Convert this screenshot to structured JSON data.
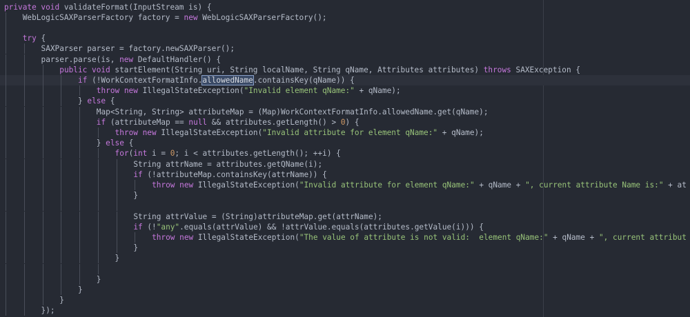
{
  "editor": {
    "highlight_color": "#c678dd",
    "string_color": "#98c379",
    "current_line": 8,
    "lines": [
      {
        "indent": 0,
        "tokens": [
          [
            "kw",
            "private void "
          ],
          [
            "pl",
            "validateFormat(InputStream is) {"
          ]
        ]
      },
      {
        "indent": 1,
        "tokens": [
          [
            "pl",
            "WebLogicSAXParserFactory factory = "
          ],
          [
            "kw",
            "new "
          ],
          [
            "pl",
            "WebLogicSAXParserFactory();"
          ]
        ]
      },
      {
        "indent": 1,
        "tokens": []
      },
      {
        "indent": 1,
        "tokens": [
          [
            "kw",
            "try "
          ],
          [
            "pl",
            "{"
          ]
        ]
      },
      {
        "indent": 2,
        "tokens": [
          [
            "pl",
            "SAXParser parser = factory.newSAXParser();"
          ]
        ]
      },
      {
        "indent": 2,
        "tokens": [
          [
            "pl",
            "parser.parse(is, "
          ],
          [
            "kw",
            "new "
          ],
          [
            "pl",
            "DefaultHandler() {"
          ]
        ]
      },
      {
        "indent": 3,
        "tokens": [
          [
            "kw",
            "public void "
          ],
          [
            "pl",
            "startElement(String uri, String localName, String qName, Attributes attributes) "
          ],
          [
            "kw",
            "throws "
          ],
          [
            "pl",
            "SAXException {"
          ]
        ]
      },
      {
        "indent": 4,
        "tokens": [
          [
            "kw",
            "if "
          ],
          [
            "pl",
            "(!WorkContextFormatInfo."
          ],
          [
            "hl",
            "allowedName"
          ],
          [
            "pl",
            ".containsKey(qName)) {"
          ]
        ]
      },
      {
        "indent": 5,
        "tokens": [
          [
            "kw",
            "throw new "
          ],
          [
            "pl",
            "IllegalStateException("
          ],
          [
            "str",
            "\"Invalid element qName:\""
          ],
          [
            "pl",
            " + qName);"
          ]
        ]
      },
      {
        "indent": 4,
        "tokens": [
          [
            "pl",
            "} "
          ],
          [
            "kw",
            "else "
          ],
          [
            "pl",
            "{"
          ]
        ]
      },
      {
        "indent": 5,
        "tokens": [
          [
            "pl",
            "Map<String, String> attributeMap = (Map)WorkContextFormatInfo.allowedName.get(qName);"
          ]
        ]
      },
      {
        "indent": 5,
        "tokens": [
          [
            "kw",
            "if "
          ],
          [
            "pl",
            "(attributeMap == "
          ],
          [
            "kw",
            "null "
          ],
          [
            "pl",
            "&& attributes.getLength() > "
          ],
          [
            "num",
            "0"
          ],
          [
            "pl",
            ") {"
          ]
        ]
      },
      {
        "indent": 6,
        "tokens": [
          [
            "kw",
            "throw new "
          ],
          [
            "pl",
            "IllegalStateException("
          ],
          [
            "str",
            "\"Invalid attribute for element qName:\""
          ],
          [
            "pl",
            " + qName);"
          ]
        ]
      },
      {
        "indent": 5,
        "tokens": [
          [
            "pl",
            "} "
          ],
          [
            "kw",
            "else "
          ],
          [
            "pl",
            "{"
          ]
        ]
      },
      {
        "indent": 6,
        "tokens": [
          [
            "kw",
            "for"
          ],
          [
            "pl",
            "("
          ],
          [
            "kw",
            "int "
          ],
          [
            "pl",
            "i = "
          ],
          [
            "num",
            "0"
          ],
          [
            "pl",
            "; i < attributes.getLength(); ++i) {"
          ]
        ]
      },
      {
        "indent": 7,
        "tokens": [
          [
            "pl",
            "String attrName = attributes.getQName(i);"
          ]
        ]
      },
      {
        "indent": 7,
        "tokens": [
          [
            "kw",
            "if "
          ],
          [
            "pl",
            "(!attributeMap.containsKey(attrName)) {"
          ]
        ]
      },
      {
        "indent": 8,
        "tokens": [
          [
            "kw",
            "throw new "
          ],
          [
            "pl",
            "IllegalStateException("
          ],
          [
            "str",
            "\"Invalid attribute for element qName:\""
          ],
          [
            "pl",
            " + qName + "
          ],
          [
            "str",
            "\", current attribute Name is:\""
          ],
          [
            "pl",
            " + at"
          ]
        ]
      },
      {
        "indent": 7,
        "tokens": [
          [
            "pl",
            "}"
          ]
        ]
      },
      {
        "indent": 7,
        "tokens": []
      },
      {
        "indent": 7,
        "tokens": [
          [
            "pl",
            "String attrValue = (String)attributeMap.get(attrName);"
          ]
        ]
      },
      {
        "indent": 7,
        "tokens": [
          [
            "kw",
            "if "
          ],
          [
            "pl",
            "(!"
          ],
          [
            "str",
            "\"any\""
          ],
          [
            "pl",
            ".equals(attrValue) && !attrValue.equals(attributes.getValue(i))) {"
          ]
        ]
      },
      {
        "indent": 8,
        "tokens": [
          [
            "kw",
            "throw new "
          ],
          [
            "pl",
            "IllegalStateException("
          ],
          [
            "str",
            "\"The value of attribute is not valid:  element qName:\""
          ],
          [
            "pl",
            " + qName + "
          ],
          [
            "str",
            "\", current attribut"
          ]
        ]
      },
      {
        "indent": 7,
        "tokens": [
          [
            "pl",
            "}"
          ]
        ]
      },
      {
        "indent": 6,
        "tokens": [
          [
            "pl",
            "}"
          ]
        ]
      },
      {
        "indent": 6,
        "tokens": []
      },
      {
        "indent": 5,
        "tokens": [
          [
            "pl",
            "}"
          ]
        ]
      },
      {
        "indent": 4,
        "tokens": [
          [
            "pl",
            "}"
          ]
        ]
      },
      {
        "indent": 3,
        "tokens": [
          [
            "pl",
            "}"
          ]
        ]
      },
      {
        "indent": 2,
        "tokens": [
          [
            "pl",
            "});"
          ]
        ]
      }
    ]
  }
}
